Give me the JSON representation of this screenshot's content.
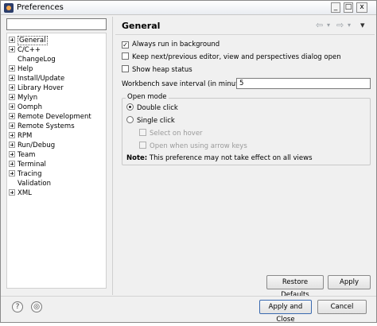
{
  "window": {
    "title": "Preferences",
    "minimize_label": "_",
    "maximize_label": "□",
    "close_label": "x"
  },
  "tree": {
    "filter_value": "",
    "items": [
      {
        "label": "General",
        "expandable": true,
        "selected": true
      },
      {
        "label": "C/C++",
        "expandable": true
      },
      {
        "label": "ChangeLog",
        "expandable": false
      },
      {
        "label": "Help",
        "expandable": true
      },
      {
        "label": "Install/Update",
        "expandable": true
      },
      {
        "label": "Library Hover",
        "expandable": true
      },
      {
        "label": "Mylyn",
        "expandable": true
      },
      {
        "label": "Oomph",
        "expandable": true
      },
      {
        "label": "Remote Development",
        "expandable": true
      },
      {
        "label": "Remote Systems",
        "expandable": true
      },
      {
        "label": "RPM",
        "expandable": true
      },
      {
        "label": "Run/Debug",
        "expandable": true
      },
      {
        "label": "Team",
        "expandable": true
      },
      {
        "label": "Terminal",
        "expandable": true
      },
      {
        "label": "Tracing",
        "expandable": true
      },
      {
        "label": "Validation",
        "expandable": false
      },
      {
        "label": "XML",
        "expandable": true
      }
    ]
  },
  "page": {
    "title": "General",
    "nav": {
      "back_icon": "⇦",
      "forward_icon": "⇨",
      "menu_icon": "▾",
      "dropdown_icon": "▾"
    },
    "always_run_background": {
      "label": "Always run in background",
      "checked": true
    },
    "keep_next_prev": {
      "label": "Keep next/previous editor, view and perspectives dialog open",
      "checked": false
    },
    "show_heap": {
      "label": "Show heap status",
      "checked": false
    },
    "save_interval": {
      "label": "Workbench save interval (in minutes):",
      "value": "5"
    },
    "open_mode": {
      "title": "Open mode",
      "double_click": {
        "label": "Double click",
        "checked": true
      },
      "single_click": {
        "label": "Single click",
        "checked": false
      },
      "select_on_hover": {
        "label": "Select on hover",
        "checked": false,
        "enabled": false
      },
      "open_arrow_keys": {
        "label": "Open when using arrow keys",
        "checked": false,
        "enabled": false
      }
    },
    "note": {
      "prefix": "Note:",
      "text": " This preference may not take effect on all views"
    },
    "restore_defaults": "Restore Defaults",
    "apply": "Apply"
  },
  "footer": {
    "help_icon": "?",
    "import_icon": "◎",
    "apply_and_close": "Apply and Close",
    "cancel": "Cancel"
  }
}
